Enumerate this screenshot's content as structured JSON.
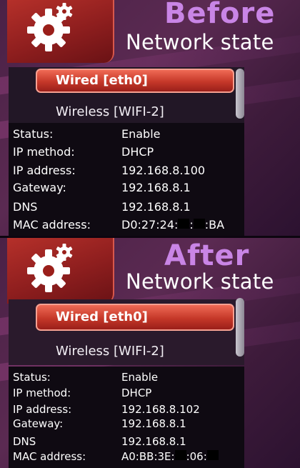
{
  "before": {
    "tag": "Before",
    "title": "Network state",
    "tabs": [
      {
        "label": "Wired [eth0]",
        "selected": true
      },
      {
        "label": "Wireless [WIFI-2]",
        "selected": false
      }
    ],
    "info": {
      "status_label": "Status:",
      "status_value": "Enable",
      "method_label": "IP method:",
      "method_value": "DHCP",
      "ip_label": "IP address:",
      "ip_value": "192.168.8.100",
      "gateway_label": "Gateway:",
      "gateway_value": "192.168.8.1",
      "dns_label": "DNS",
      "dns_value": "192.168.8.1",
      "mac_label": "MAC address:",
      "mac_parts": [
        "D0:27:24:",
        ":",
        ":BA"
      ]
    }
  },
  "after": {
    "tag": "After",
    "title": "Network state",
    "tabs": [
      {
        "label": "Wired [eth0]",
        "selected": true
      },
      {
        "label": "Wireless [WIFI-2]",
        "selected": false
      }
    ],
    "info": {
      "status_label": "Status:",
      "status_value": "Enable",
      "method_label": "IP method:",
      "method_value": "DHCP",
      "ip_label": "IP address:",
      "ip_value": "192.168.8.102",
      "gateway_label": "Gateway:",
      "gateway_value": "192.168.8.1",
      "dns_label": "DNS",
      "dns_value": "192.168.8.1",
      "mac_label": "MAC address:",
      "mac_parts": [
        "A0:BB:3E:",
        ":06:",
        ""
      ]
    }
  },
  "colors": {
    "accent_red": "#c53829",
    "tag_purple": "#c985e6",
    "background": "#4a2146"
  },
  "icons": {
    "settings": "gear-icon"
  }
}
